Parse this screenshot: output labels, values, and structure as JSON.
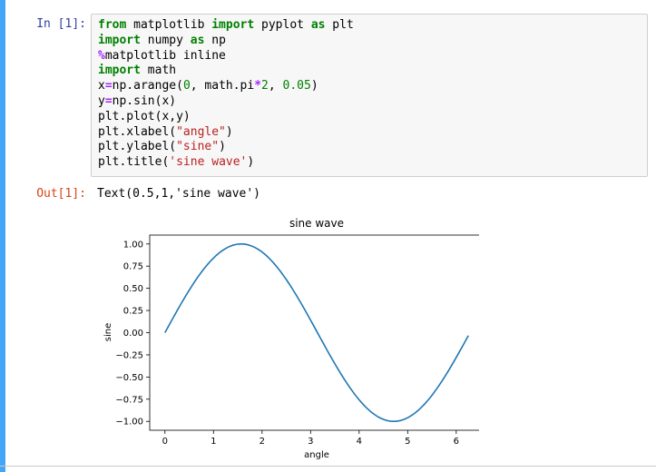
{
  "cell": {
    "in_prompt": "In [1]:",
    "out_prompt": "Out[1]:",
    "code_lines": [
      [
        {
          "t": "from",
          "c": "kw"
        },
        {
          "t": " matplotlib ",
          "c": ""
        },
        {
          "t": "import",
          "c": "kw"
        },
        {
          "t": " pyplot ",
          "c": ""
        },
        {
          "t": "as",
          "c": "kw"
        },
        {
          "t": " plt",
          "c": ""
        }
      ],
      [
        {
          "t": "import",
          "c": "kw"
        },
        {
          "t": " numpy ",
          "c": ""
        },
        {
          "t": "as",
          "c": "kw"
        },
        {
          "t": " np",
          "c": ""
        }
      ],
      [
        {
          "t": "%",
          "c": "op"
        },
        {
          "t": "matplotlib inline",
          "c": ""
        }
      ],
      [
        {
          "t": "import",
          "c": "kw"
        },
        {
          "t": " math",
          "c": ""
        }
      ],
      [
        {
          "t": "x",
          "c": ""
        },
        {
          "t": "=",
          "c": "op"
        },
        {
          "t": "np.arange(",
          "c": ""
        },
        {
          "t": "0",
          "c": "num"
        },
        {
          "t": ", math.pi",
          "c": ""
        },
        {
          "t": "*",
          "c": "op"
        },
        {
          "t": "2",
          "c": "num"
        },
        {
          "t": ", ",
          "c": ""
        },
        {
          "t": "0.05",
          "c": "num"
        },
        {
          "t": ")",
          "c": ""
        }
      ],
      [
        {
          "t": "y",
          "c": ""
        },
        {
          "t": "=",
          "c": "op"
        },
        {
          "t": "np.sin(x)",
          "c": ""
        }
      ],
      [
        {
          "t": "plt.plot(x,y)",
          "c": ""
        }
      ],
      [
        {
          "t": "plt.xlabel(",
          "c": ""
        },
        {
          "t": "\"angle\"",
          "c": "str"
        },
        {
          "t": ")",
          "c": ""
        }
      ],
      [
        {
          "t": "plt.ylabel(",
          "c": ""
        },
        {
          "t": "\"sine\"",
          "c": "str"
        },
        {
          "t": ")",
          "c": ""
        }
      ],
      [
        {
          "t": "plt.title(",
          "c": ""
        },
        {
          "t": "'sine wave'",
          "c": "str"
        },
        {
          "t": ")",
          "c": ""
        }
      ]
    ],
    "output_text": "Text(0.5,1,'sine wave')"
  },
  "colors": {
    "line": "#1f77b4",
    "in_prompt": "#303f9f",
    "out_prompt": "#d84315",
    "left_bar": "#42a5f5"
  },
  "chart_data": {
    "type": "line",
    "title": "sine wave",
    "xlabel": "angle",
    "ylabel": "sine",
    "x_start": 0,
    "x_stop": 6.2832,
    "x_step": 0.05,
    "function": "sin",
    "xlim": [
      -0.314,
      6.564
    ],
    "ylim": [
      -1.1,
      1.1
    ],
    "xticks": [
      0,
      1,
      2,
      3,
      4,
      5,
      6
    ],
    "xtick_labels": [
      "0",
      "1",
      "2",
      "3",
      "4",
      "5",
      "6"
    ],
    "yticks": [
      1.0,
      0.75,
      0.5,
      0.25,
      0.0,
      -0.25,
      -0.5,
      -0.75,
      -1.0
    ],
    "ytick_labels": [
      "1.00",
      "0.75",
      "0.50",
      "0.25",
      "0.00",
      "−0.25",
      "−0.50",
      "−0.75",
      "−1.00"
    ],
    "grid": false,
    "legend": false
  }
}
